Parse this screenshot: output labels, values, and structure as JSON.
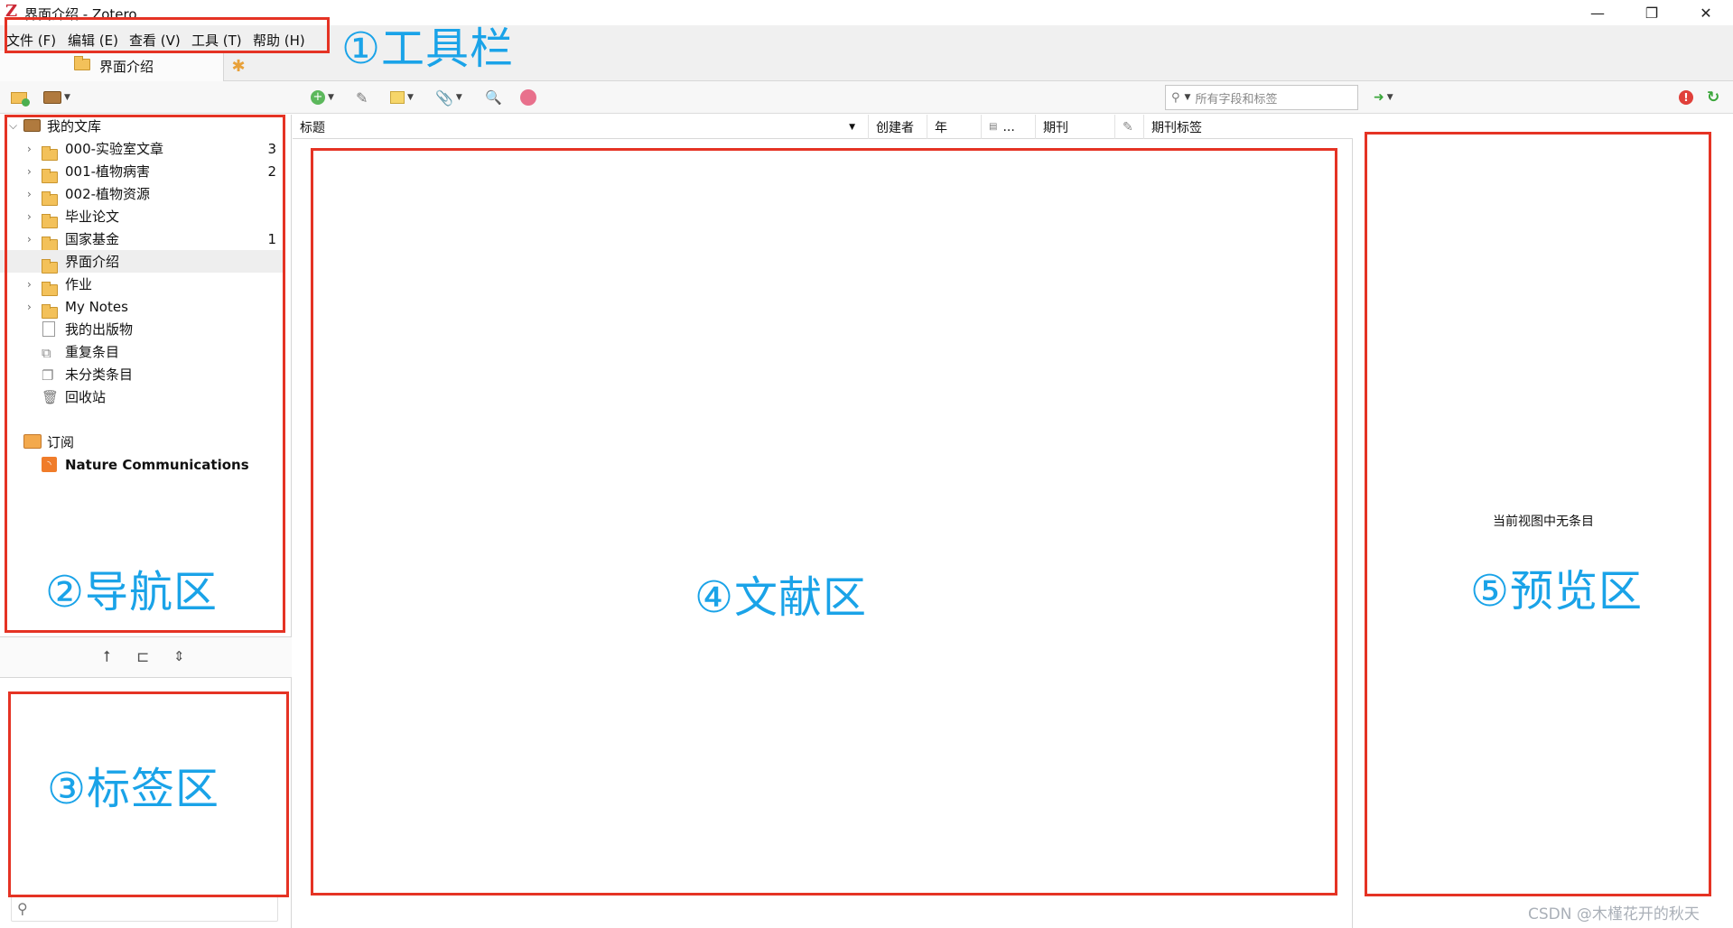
{
  "window": {
    "title": "界面介绍 - Zotero",
    "logo_letter": "Z",
    "minimize": "—",
    "maximize": "❐",
    "close": "✕"
  },
  "menubar": {
    "items": [
      "文件 (F)",
      "编辑 (E)",
      "查看 (V)",
      "工具 (T)",
      "帮助 (H)"
    ]
  },
  "tabs": {
    "main_label": "界面介绍"
  },
  "toolbar": {
    "search_placeholder": "所有字段和标签"
  },
  "collections": {
    "library": "我的文库",
    "items": [
      {
        "label": "000-实验室文章",
        "count": "3"
      },
      {
        "label": "001-植物病害",
        "count": "2"
      },
      {
        "label": "002-植物资源",
        "count": ""
      },
      {
        "label": "毕业论文",
        "count": ""
      },
      {
        "label": "国家基金",
        "count": "1"
      },
      {
        "label": "界面介绍",
        "count": ""
      },
      {
        "label": "作业",
        "count": ""
      },
      {
        "label": "My Notes",
        "count": ""
      }
    ],
    "special": [
      "我的出版物",
      "重复条目",
      "未分类条目",
      "回收站"
    ],
    "feeds_header": "订阅",
    "feed": "Nature Communications"
  },
  "items_table": {
    "columns": [
      "标题",
      "创建者",
      "年",
      "...",
      "期刊",
      "期刊标签"
    ]
  },
  "preview": {
    "empty_message": "当前视图中无条目"
  },
  "annotations": {
    "toolbar": "①工具栏",
    "nav": "②导航区",
    "tags": "③标签区",
    "items": "④文献区",
    "preview": "⑤预览区"
  },
  "watermark": "CSDN @木槿花开的秋天",
  "colors": {
    "annotation_blue": "#1aa3e8",
    "annotation_red": "#e53324",
    "folder": "#f3c15a"
  }
}
